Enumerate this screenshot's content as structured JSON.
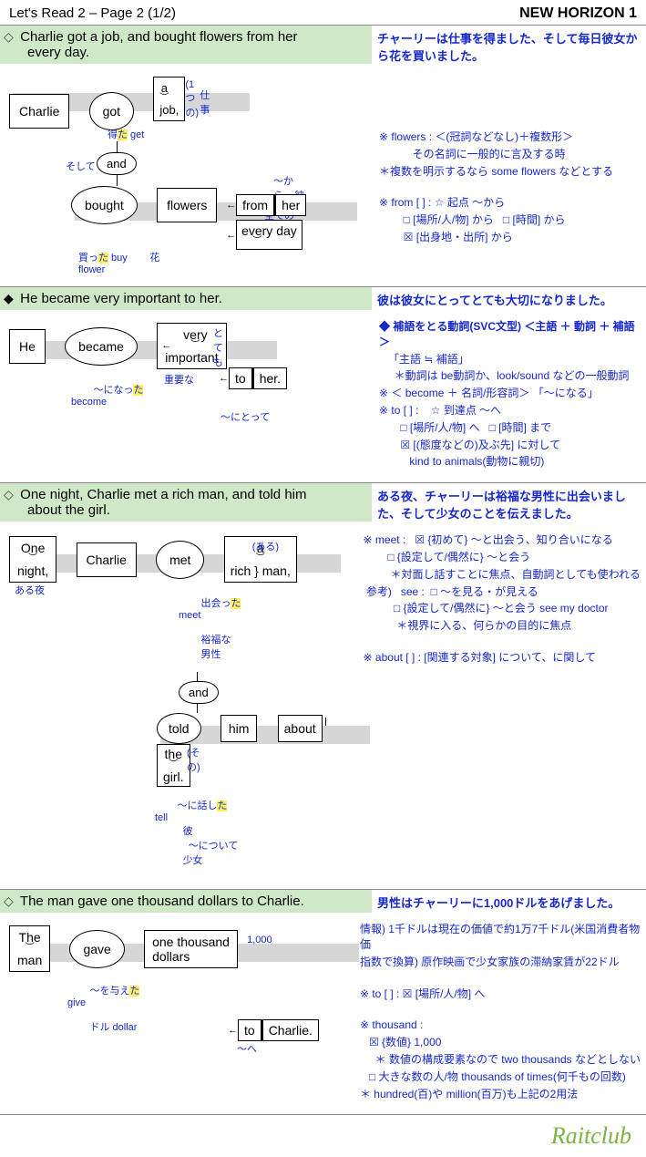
{
  "header": {
    "left": "Let's Read 2 – Page 2 (1/2)",
    "right": "NEW HORIZON 1"
  },
  "sections": [
    {
      "marker": "◇",
      "en1": "Charlie got a job, and bought flowers from her",
      "en2": "every day.",
      "jp": "チャーリーは仕事を得ました、そして毎日彼女から花を買いました。",
      "d": {
        "subj": "Charlie",
        "v1": "got",
        "v1_jp": "得",
        "v1_yl": "た",
        "v1_base": " get",
        "obj1a": "a",
        "obj1a_jp": "(1つの)",
        "obj1b": "job,",
        "obj1b_jp": "仕事",
        "conj": "and",
        "conj_jp": "そして",
        "v2": "bought",
        "v2_jp": "買っ",
        "v2_yl": "た",
        "v2_base": " buy",
        "obj2": "flowers",
        "obj2_jp": "花\nflower",
        "pp1a": "from",
        "pp1a_jp": "〜から",
        "pp1b": "her",
        "pp1b_jp": "彼女",
        "pp2a": "every",
        "pp2a_jp": "全ての",
        "pp2b": "day",
        "pp2b_jp": "日"
      },
      "notes": [
        "※ flowers :  ＜(冠詞などなし)＋複数形＞",
        "           その名詞に一般的に言及する時",
        " ＊複数を明示するなら some flowers などとする",
        "",
        "※ from [ ] :   ☆ 起点 〜から",
        "        □ [場所/人/物] から   □ [時間] から",
        "        ☒ [出身地・出所] から"
      ]
    },
    {
      "marker": "◆",
      "en1": "He became very important to her.",
      "jp": "彼は彼女にとってとても大切になりました。",
      "d": {
        "subj": "He",
        "v1": "became",
        "v1_jp": "〜になっ",
        "v1_yl": "た",
        "v1_base": "\nbecome",
        "c1": "very",
        "c1_jp": "とても",
        "c2": "important",
        "c2_jp": "重要な",
        "pp1a": "to",
        "pp1a_jp": "〜にとって",
        "pp1b": "her."
      },
      "notes": [
        "◆ 補語をとる動詞(SVC文型)  ＜主語 ＋ 動詞 ＋ 補語＞",
        "   「主語 ≒ 補語」",
        "     ＊動詞は be動詞か、look/sound などの一般動詞",
        "※ ＜ become ＋ 名詞/形容詞＞ 「〜になる」",
        "※ to [ ] :    ☆ 到達点 〜へ",
        "       □ [場所/人/物] へ   □ [時間] まで",
        "       ☒ [(態度などの)及ぶ先] に対して",
        "          kind to animals(動物に親切)"
      ]
    },
    {
      "marker": "◇",
      "en1": "One night, Charlie met a rich man, and told him",
      "en2": "about the girl.",
      "jp": "ある夜、チャーリーは裕福な男性に出会いました、そして少女のことを伝えました。",
      "d": {
        "adv": "One",
        "adv2": "night,",
        "adv_jp": "ある夜",
        "subj": "Charlie",
        "v1": "met",
        "v1_jp": "出会っ",
        "v1_yl": "た",
        "v1_base": "\nmeet",
        "o1a": "a",
        "o1a_jp": "(ある)",
        "o1b": "rich",
        "o1b_jp": "裕福な",
        "o1c": "man,",
        "o1c_jp": "男性",
        "conj": "and",
        "v2": "told",
        "v2_jp": "〜に話し",
        "v2_yl": "た",
        "v2_base": "\ntell",
        "o2": "him",
        "o2_jp": "彼",
        "pp1": "about",
        "pp1_jp": "〜について",
        "pp2a": "the",
        "pp2a_jp": "(その)",
        "pp2b": "girl.",
        "pp2b_jp": "少女"
      },
      "notes": [
        "※ meet :   ☒ {初めて} 〜と出会う、知り合いになる",
        "        □ {設定して/偶然に} 〜と会う",
        "         ＊対面し話すことに焦点、自動詞としても使われる",
        " 参考)   see :  □ 〜を見る・が見える",
        "          □ {設定して/偶然に} 〜と会う see my doctor",
        "           ＊視界に入る、何らかの目的に焦点",
        "",
        "※ about [ ] :  [関連する対象] について、に関して"
      ]
    },
    {
      "marker": "◇",
      "en1": "The man gave one thousand dollars to Charlie.",
      "jp": "男性はチャーリーに1,000ドルをあげました。",
      "d": {
        "subj1": "The",
        "subj2": "man",
        "v1": "gave",
        "v1_jp": "〜を与え",
        "v1_yl": "た",
        "v1_base": "\ngive",
        "o1": "one thousand",
        "o1_jp": "1,000",
        "o2": "dollars",
        "o2_jp": "ドル dollar",
        "pp1a": "to",
        "pp1a_jp": "〜へ",
        "pp1b": "Charlie."
      },
      "notes": [
        "情報)  1千ドルは現在の価値で約1万7千ドル(米国消費者物価",
        "  指数で換算)  原作映画で少女家族の滞納家賃が22ドル",
        "",
        "※ to [ ] :  ☒ [場所/人/物] へ",
        "",
        "※ thousand :",
        "   ☒ {数値} 1,000",
        "     ＊ 数値の構成要素なので two thousands などとしない",
        "   □ 大きな数の人/物 thousands of times(何千もの回数)",
        " ＊ hundred(百)や million(百万)も上記の2用法"
      ]
    }
  ],
  "footer": "Raitclub"
}
